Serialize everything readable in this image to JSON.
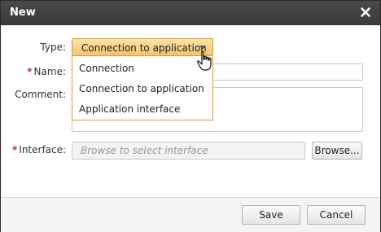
{
  "dialog": {
    "title": "New"
  },
  "form": {
    "type_label": "Type:",
    "type_value": "Connection to application",
    "type_options": [
      "Connection",
      "Connection to application",
      "Application interface"
    ],
    "name_required": "*",
    "name_label": "Name:",
    "name_value": "",
    "comment_label": "Comment:",
    "comment_value": "",
    "interface_required": "*",
    "interface_label": "Interface:",
    "interface_placeholder": "Browse to select interface",
    "browse_label": "Browse..."
  },
  "footer": {
    "save_label": "Save",
    "cancel_label": "Cancel"
  },
  "colors": {
    "titlebar": "#3f3f3f",
    "required": "#d9232d",
    "select_active": "#f4c36b"
  }
}
